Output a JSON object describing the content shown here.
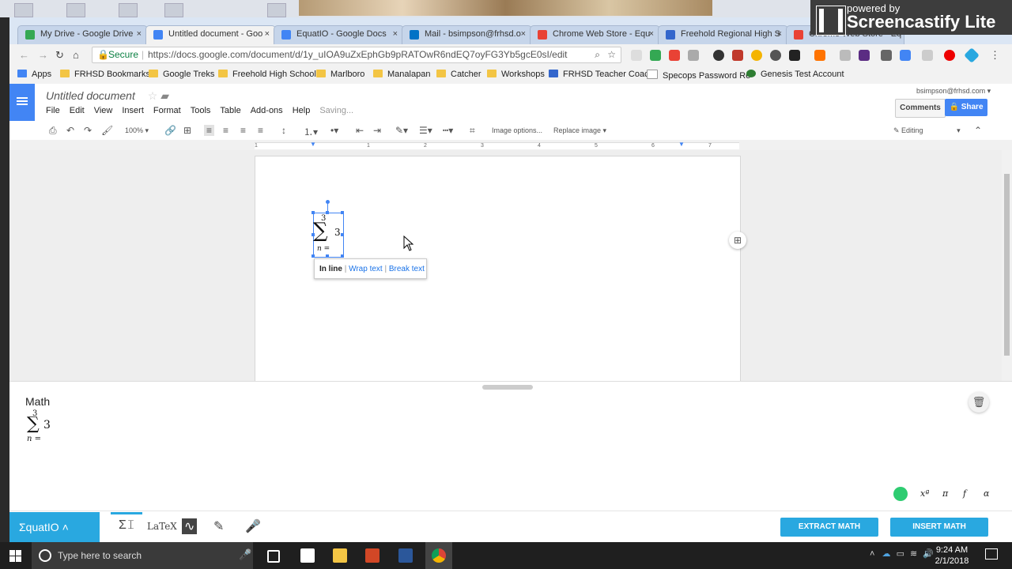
{
  "screencastify": {
    "line1": "powered by",
    "line2": "Screencastify Lite"
  },
  "tabs": [
    {
      "title": "My Drive - Google Drive",
      "icon_color": "#34a853"
    },
    {
      "title": "Untitled document - Goo",
      "icon_color": "#4285f4"
    },
    {
      "title": "EquatIO - Google Docs",
      "icon_color": "#4285f4"
    },
    {
      "title": "Mail - bsimpson@frhsd.o",
      "icon_color": "#0072c6"
    },
    {
      "title": "Chrome Web Store - Equ",
      "icon_color": "#e94235"
    },
    {
      "title": "Freehold Regional High S",
      "icon_color": "#3366cc"
    },
    {
      "title": "Chrome Web Store - Eq",
      "icon_color": "#e94235"
    }
  ],
  "tab_close": "×",
  "window_controls": {
    "minimize": "–",
    "restore": "❐",
    "close": "✕"
  },
  "address": {
    "secure_label": "Secure",
    "url": "https://docs.google.com/document/d/1y_uIOA9uZxEphGb9pRATOwR6ndEQ7oyFG3Yb5gcE0sI/edit",
    "lock_icon": "🔒"
  },
  "bookmarks": [
    "Apps",
    "FRHSD Bookmarks",
    "Google Treks",
    "Freehold High School",
    "Marlboro",
    "Manalapan",
    "Catcher",
    "Workshops",
    "FRHSD Teacher Coach",
    "Specops Password Re",
    "Genesis Test Account"
  ],
  "doc": {
    "title": "Untitled document",
    "menus": [
      "File",
      "Edit",
      "View",
      "Insert",
      "Format",
      "Tools",
      "Table",
      "Add-ons",
      "Help"
    ],
    "saving": "Saving...",
    "account": "bsimpson@frhsd.com",
    "comments_label": "Comments",
    "share_label": "Share",
    "zoom": "100%",
    "image_options": "Image options...",
    "replace_image": "Replace image",
    "editing_label": "Editing",
    "ruler_marks": [
      "1",
      "1",
      "2",
      "3",
      "4",
      "5",
      "6",
      "7"
    ]
  },
  "equation": {
    "upper": "3",
    "sigma": "∑",
    "lower": "n =",
    "term": "3"
  },
  "image_popup": {
    "inline": "In line",
    "wrap": "Wrap text",
    "break": "Break text",
    "sep": "|"
  },
  "equatio": {
    "section_label": "Math",
    "brand": "ΣquatIO",
    "tools": [
      "Σ𝙸",
      "LaTeX",
      "∿",
      "✎",
      "🎤"
    ],
    "extract_label": "EXTRACT MATH",
    "insert_label": "INSERT MATH",
    "math_symbols": [
      "xª",
      "π",
      "f",
      "α"
    ],
    "colors": {
      "accent": "#29a8e0"
    }
  },
  "taskbar": {
    "search_placeholder": "Type here to search",
    "time": "9:24 AM",
    "date": "2/1/2018"
  }
}
